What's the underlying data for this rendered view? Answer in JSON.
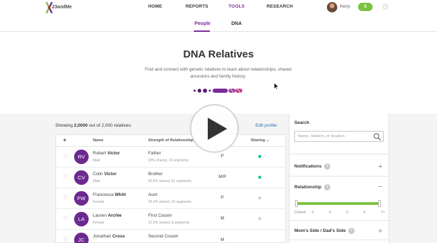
{
  "topnav": {
    "logo_text": "23andMe",
    "links": [
      "HOME",
      "REPORTS",
      "TOOLS",
      "RESEARCH"
    ],
    "active_link": "TOOLS",
    "user_name": "Kerry",
    "badge_count": "5",
    "icons": [
      "23andme-logo-icon",
      "user-avatar",
      "gear-icon"
    ]
  },
  "subnav": {
    "tabs": [
      "People",
      "DNA"
    ],
    "active_tab": "People"
  },
  "hero": {
    "title": "DNA Relatives",
    "description": "Find and connect with genetic relatives to learn about relationships, shared ancestors and family history."
  },
  "results": {
    "showing_prefix": "Showing",
    "showing_count": "2,0000",
    "showing_suffix": " out of 2,000 relatives.",
    "edit_profile": "Edit profile",
    "headers": {
      "star": "★",
      "name": "Name",
      "strength": "Strength of Relationship",
      "sharing": "Sharing"
    },
    "rows": [
      {
        "initials": "RV",
        "first": "Robert",
        "last": "Victor",
        "sex": "Male",
        "relationship": "Father",
        "shared": "50% shared, 23 segments",
        "side": "P",
        "sharing_color": "#1cc0a0"
      },
      {
        "initials": "CV",
        "first": "Colin",
        "last": "Victor",
        "sex": "Male",
        "relationship": "Brother",
        "shared": "42.6% shared, 51 segments",
        "side": "M/P",
        "sharing_color": "#1cc0a0"
      },
      {
        "initials": "FW",
        "first": "Francesca",
        "last": "Whitt",
        "sex": "Female",
        "relationship": "Aunt",
        "shared": "25.2% shared, 10 segments",
        "side": "P",
        "sharing_color": "#d0d0d0"
      },
      {
        "initials": "LA",
        "first": "Lauren",
        "last": "Archie",
        "sex": "Female",
        "relationship": "First Cousin",
        "shared": "12.5% shared, 8 segments",
        "side": "M",
        "sharing_color": "#d0d0d0"
      },
      {
        "initials": "JC",
        "first": "Jonathan",
        "last": "Cross",
        "sex": "",
        "relationship": "Second Cousin",
        "shared": "",
        "side": "M",
        "sharing_color": "#d0d0d0"
      }
    ]
  },
  "sidebar": {
    "search_title": "Search",
    "search_placeholder": "Name, relation, or location",
    "sections": {
      "notifications": "Notifications",
      "relationship": "Relationship",
      "side": "Mom's Side / Dad's Side"
    },
    "slider_labels": [
      "Closest",
      "3",
      "4",
      "5",
      "6",
      "7+"
    ]
  },
  "media": {
    "play_icon": "play-icon"
  },
  "colors": {
    "accent": "#7b2c9a",
    "green": "#7cc242",
    "link": "#2b6fb4"
  }
}
